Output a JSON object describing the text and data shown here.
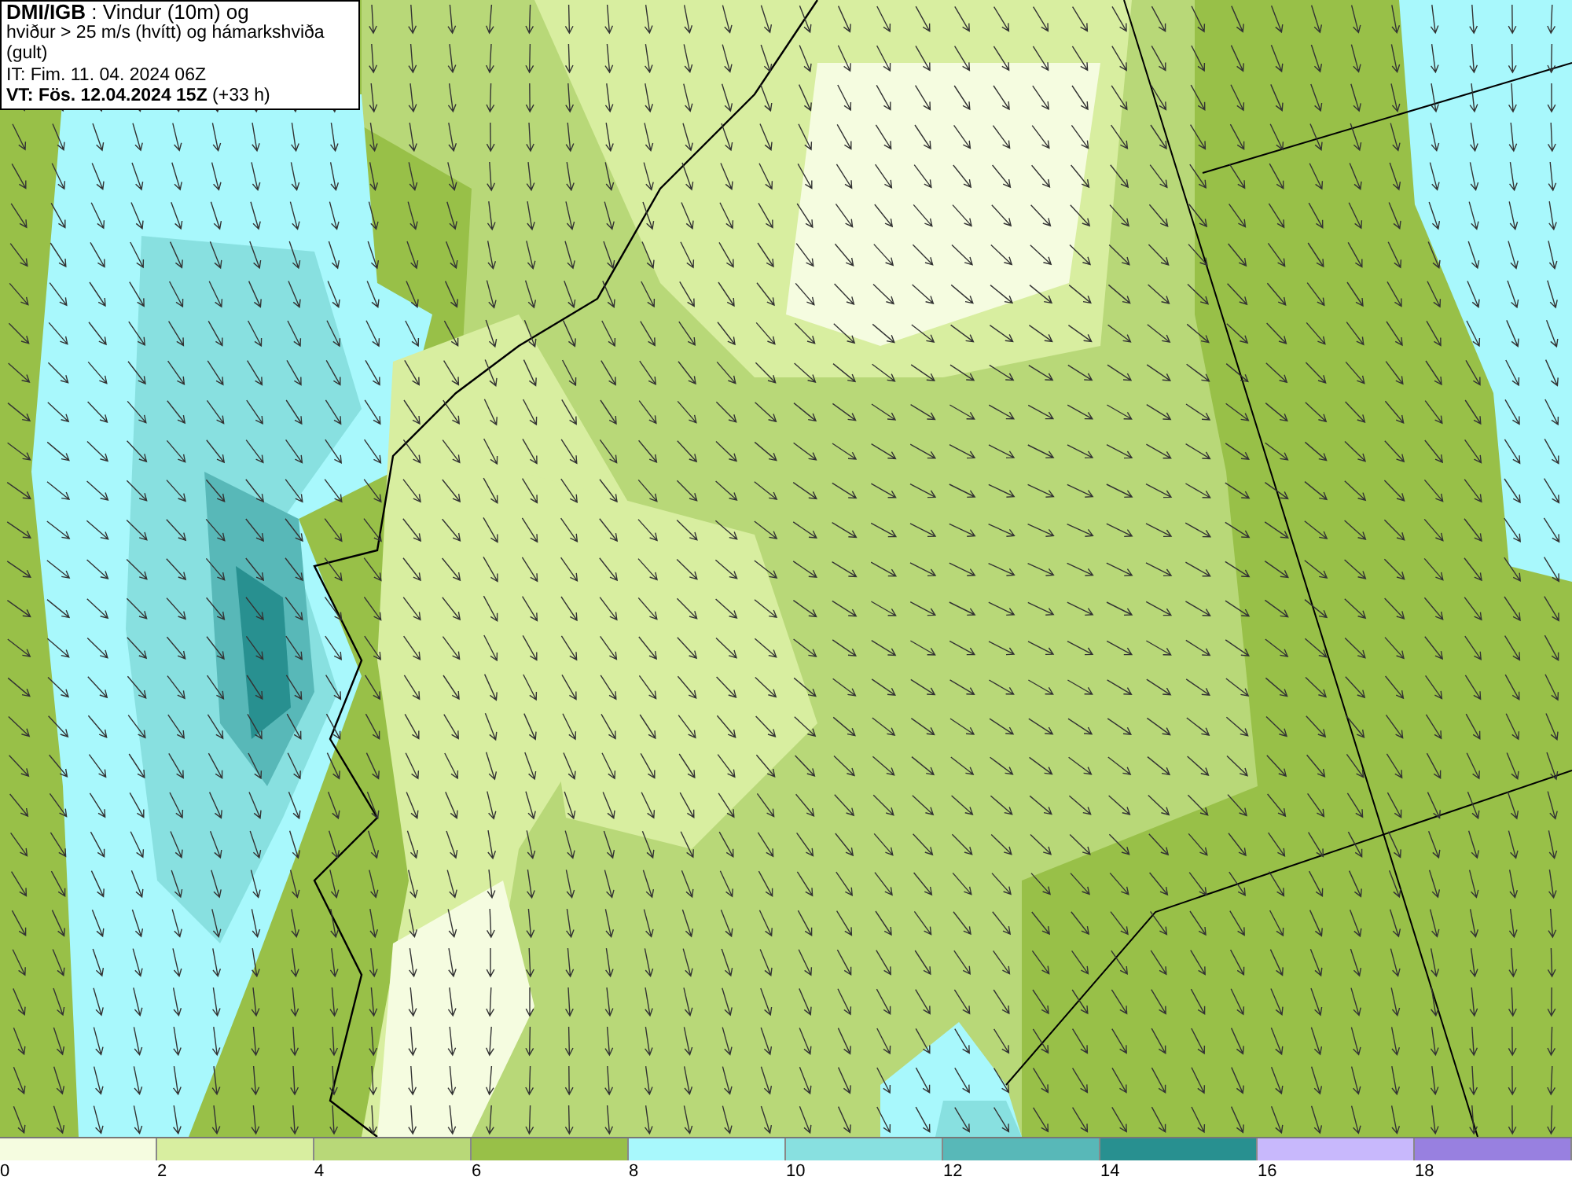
{
  "info_box": {
    "lines": [
      "**DMI/IGB** : Vindur (10m) og",
      "hviður > 25 m/s (hvítt) og hámarkshviða (gult)",
      "IT: Fim. 11. 04. 2024 06Z",
      "**VT: Fös. 12.04.2024 15Z** (+33 h)"
    ]
  },
  "legend": [
    {
      "label": "0",
      "color": "#f5fce0"
    },
    {
      "label": "2",
      "color": "#d8eea0"
    },
    {
      "label": "4",
      "color": "#b8d878"
    },
    {
      "label": "6",
      "color": "#98c048"
    },
    {
      "label": "8",
      "color": "#a8f8fc"
    },
    {
      "label": "10",
      "color": "#88e0e0"
    },
    {
      "label": "12",
      "color": "#58b8b8"
    },
    {
      "label": "14",
      "color": "#289090"
    },
    {
      "label": "16",
      "color": "#c8b8fc"
    },
    {
      "label": "18",
      "color": "#9880e0"
    }
  ]
}
